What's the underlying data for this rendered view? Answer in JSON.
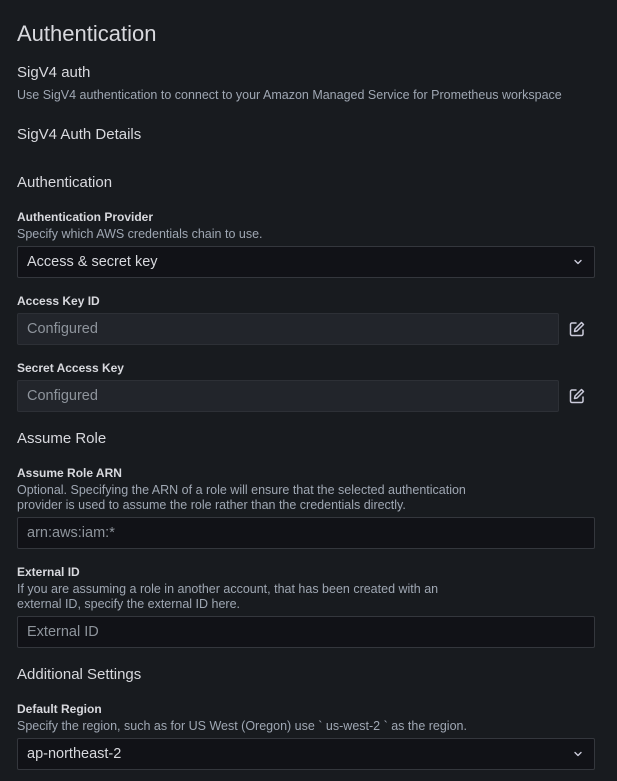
{
  "page_title": "Authentication",
  "sigv4": {
    "title": "SigV4 auth",
    "description": "Use SigV4 authentication to connect to your Amazon Managed Service for Prometheus workspace"
  },
  "details_title": "SigV4 Auth Details",
  "auth_section": "Authentication",
  "provider": {
    "label": "Authentication Provider",
    "description": "Specify which AWS credentials chain to use.",
    "value": "Access & secret key"
  },
  "access_key": {
    "label": "Access Key ID",
    "value": "Configured"
  },
  "secret_key": {
    "label": "Secret Access Key",
    "value": "Configured"
  },
  "assume_role_section": "Assume Role",
  "role_arn": {
    "label": "Assume Role ARN",
    "description_line1": "Optional. Specifying the ARN of a role will ensure that the selected authentication",
    "description_line2": "provider is used to assume the role rather than the credentials directly.",
    "placeholder": "arn:aws:iam:*"
  },
  "external_id": {
    "label": "External ID",
    "description_line1": "If you are assuming a role in another account, that has been created with an",
    "description_line2": "external ID, specify the external ID here.",
    "placeholder": "External ID"
  },
  "additional_section": "Additional Settings",
  "region": {
    "label": "Default Region",
    "description": "Specify the region, such as for US West (Oregon) use ` us-west-2 ` as the region.",
    "value": "ap-northeast-2"
  },
  "icons": {
    "dropdown": "chevron-down-icon",
    "edit": "pen-to-square-icon"
  }
}
